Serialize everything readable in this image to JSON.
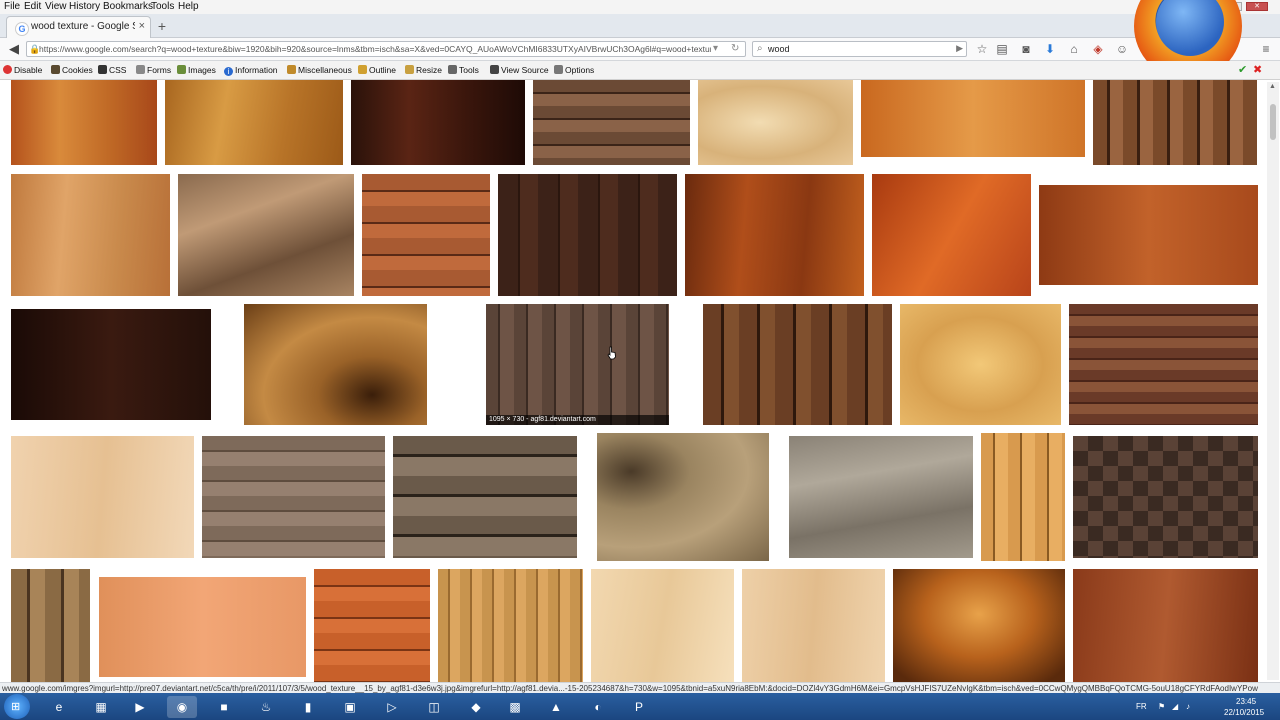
{
  "menu": [
    "File",
    "Edit",
    "View",
    "History",
    "Bookmarks",
    "Tools",
    "Help"
  ],
  "tab": {
    "title": "wood texture - Google Sear...",
    "close": "×",
    "new": "+"
  },
  "url": "https://www.google.com/search?q=wood+texture&biw=1920&bih=920&source=lnms&tbm=isch&sa=X&ved=0CAYQ_AUoAWoVChMI6833UTXyAIVBrwUCh3OAg6l#q=wood+texture&tbm=",
  "search": {
    "value": "wood"
  },
  "devbar": [
    "Disable",
    "Cookies",
    "CSS",
    "Forms",
    "Images",
    "Information",
    "Miscellaneous",
    "Outline",
    "Resize",
    "Tools",
    "View Source",
    "Options"
  ],
  "caption": "1095 × 730 - agf81.deviantart.com",
  "status": "www.google.com/imgres?imgurl=http://pre07.deviantart.net/c5ca/th/pre/i/2011/107/3/5/wood_texture__15_by_agf81-d3e6w3j.jpg&imgrefurl=http://agf81.devia...-15-205234687&h=730&w=1095&tbnid=a5xuN9ria8EbM:&docid=DOZl4vY3GdmH6M&ei=GmcpVsHJFIS7UZeNvIgK&tbm=isch&ved=0CCwQMygQMBBqFQoTCMG-5ouU18gCFYRdFAodIwYPow",
  "tray": {
    "lang": "FR",
    "time": "23:45",
    "date": "22/10/2015"
  },
  "colors": {
    "tab_bg": "#e3e8ee",
    "taskbar": "#1f4f8e",
    "accent": "#4285f4"
  },
  "icons": [
    "back-arrow",
    "search-icon",
    "bookmark-star",
    "downloads",
    "home",
    "firefox-logo",
    "windows-start"
  ]
}
